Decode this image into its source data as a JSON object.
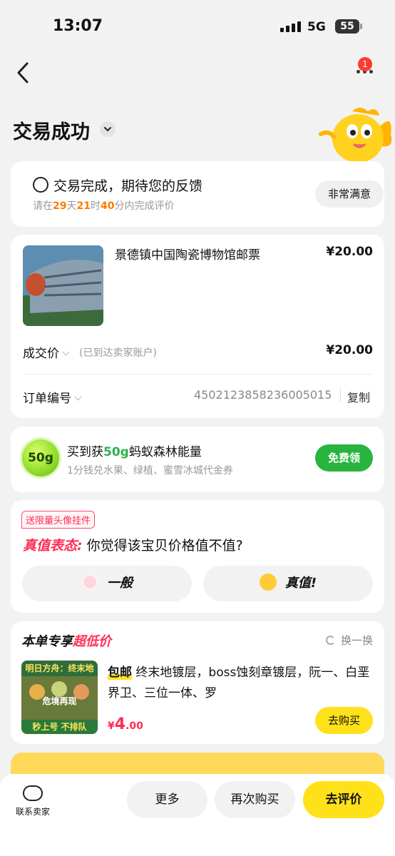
{
  "status_bar": {
    "time": "13:07",
    "network": "5G",
    "battery": "55"
  },
  "nav": {
    "notification_count": "1"
  },
  "page": {
    "title": "交易成功"
  },
  "review_prompt": {
    "title": "交易完成，期待您的反馈",
    "sub_prefix": "请在",
    "days": "29",
    "days_unit": "天",
    "hours": "21",
    "hours_unit": "时",
    "minutes": "40",
    "sub_suffix": "分内完成评价",
    "button": "非常满意"
  },
  "product": {
    "name": "景德镇中国陶瓷博物馆邮票",
    "price": "¥20.00",
    "deal_label": "成交价",
    "deal_note": "(已到达卖家账户)",
    "deal_price": "¥20.00",
    "order_label": "订单编号",
    "order_no": "4502123858236005015",
    "copy": "复制"
  },
  "energy": {
    "ball": "50g",
    "title_prefix": "买到获",
    "amount": "50g",
    "title_suffix": "蚂蚁森林能量",
    "sub": "1分钱兑水果、绿植、蜜雪冰城代金券",
    "button": "免费领"
  },
  "rating": {
    "tag": "送限量头像挂件",
    "label": "真值表态:",
    "question": " 你觉得该宝贝价格值不值?",
    "option_1": "一般",
    "option_2": "真值!"
  },
  "recommend": {
    "title_prefix": "本单专享",
    "title_hl": "超低价",
    "refresh": "换一换",
    "img_top": "明日方舟：终末地",
    "img_mid": "危境再现",
    "img_bottom": "秒上号 不排队",
    "tag": "包邮",
    "text": " 终末地镀层，boss蚀刻章镀层，阮一、白垩界卫、三位一体、罗",
    "price_symbol": "¥",
    "price_int": "4",
    "price_dec": ".00",
    "buy": "去购买"
  },
  "bottom": {
    "contact": "联系卖家",
    "more": "更多",
    "again": "再次购买",
    "review": "去评价"
  }
}
